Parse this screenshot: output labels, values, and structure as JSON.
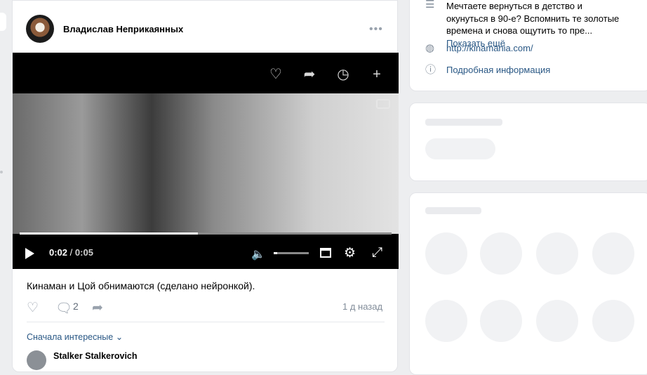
{
  "post": {
    "author": "Владислав Неприкаянных",
    "more_icon": "ellipsis-icon",
    "caption": "Кинаман и Цой обнимаются (сделано нейронкой).",
    "comments_count": "2",
    "posted_ago": "1 д назад",
    "sort_label": "Сначала интересные",
    "comment_author": "Stalker Stalkerovich"
  },
  "video": {
    "current_time": "0:02",
    "separator": "/",
    "duration": "0:05",
    "progress_fraction": 0.48,
    "volume_fraction": 0.1
  },
  "community_info": {
    "description": "Мечтаете вернуться в детство и окунуться в 90-е? Вспомнить те золотые времена и снова ощутить то пре...",
    "show_more": "Показать ещё",
    "website": "http://kinamania.com/",
    "details": "Подробная информация"
  },
  "colors": {
    "background": "#edeef0",
    "link": "#2a5885",
    "icon_gray": "#99a2ad"
  }
}
